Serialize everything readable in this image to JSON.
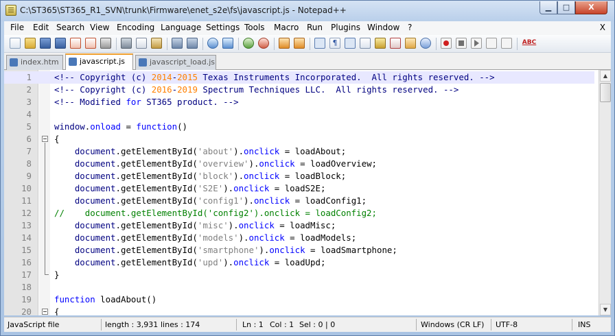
{
  "window": {
    "title": "C:\\ST365\\ST365_R1_SVN\\trunk\\Firmware\\enet_s2e\\fs\\javascript.js - Notepad++",
    "minimize": "▁",
    "maximize": "□",
    "close": "X"
  },
  "menu": {
    "items": [
      "File",
      "Edit",
      "Search",
      "View",
      "Encoding",
      "Language",
      "Settings",
      "Tools",
      "Macro",
      "Run",
      "Plugins",
      "Window",
      "?"
    ],
    "close": "X"
  },
  "toolbar": {
    "icons": [
      "new-file-icon",
      "open-file-icon",
      "save-icon",
      "save-all-icon",
      "close-icon",
      "close-all-icon",
      "print-icon",
      "cut-icon",
      "copy-icon",
      "paste-icon",
      "undo-icon",
      "redo-icon",
      "find-icon",
      "replace-icon",
      "zoom-in-icon",
      "zoom-out-icon",
      "sync-vertical-icon",
      "sync-horizontal-icon",
      "word-wrap-icon",
      "show-all-chars-icon",
      "indent-guide-icon",
      "user-lang-icon",
      "doc-map-icon",
      "function-list-icon",
      "folder-workspace-icon",
      "monitoring-icon",
      "record-macro-icon",
      "stop-macro-icon",
      "play-macro-icon",
      "run-macro-multiple-icon",
      "save-macro-icon",
      "spell-check-icon"
    ]
  },
  "tabs": [
    {
      "label": "index.htm",
      "active": false
    },
    {
      "label": "javascript.js",
      "active": true
    },
    {
      "label": "javascript_load.js",
      "active": false
    }
  ],
  "editor": {
    "lines": [
      {
        "n": "1",
        "tokens": [
          [
            "c-comment",
            "<!-- Copyright (c) "
          ],
          [
            "c-year",
            "2014"
          ],
          [
            "c-comment",
            "-"
          ],
          [
            "c-year",
            "2015"
          ],
          [
            "c-comment",
            " Texas Instruments Incorporated.  All rights reserved. -->"
          ]
        ]
      },
      {
        "n": "2",
        "tokens": [
          [
            "c-comment",
            "<!-- Copyright (c) "
          ],
          [
            "c-year",
            "2016"
          ],
          [
            "c-comment",
            "-"
          ],
          [
            "c-year",
            "2019"
          ],
          [
            "c-comment",
            " Spectrum Techniques LLC.  All rights reserved. -->"
          ]
        ]
      },
      {
        "n": "3",
        "tokens": [
          [
            "c-comment",
            "<!-- Modified "
          ],
          [
            "c-kw",
            "for"
          ],
          [
            "c-comment",
            " ST365 product. -->"
          ]
        ]
      },
      {
        "n": "4",
        "tokens": []
      },
      {
        "n": "5",
        "tokens": [
          [
            "c-obj",
            "window"
          ],
          [
            "c-plain",
            "."
          ],
          [
            "c-prop",
            "onload"
          ],
          [
            "c-plain",
            " = "
          ],
          [
            "c-kw",
            "function"
          ],
          [
            "c-plain",
            "()"
          ]
        ]
      },
      {
        "n": "6",
        "tokens": [
          [
            "c-plain",
            "{"
          ]
        ]
      },
      {
        "n": "7",
        "tokens": [
          [
            "c-plain",
            "    "
          ],
          [
            "c-obj",
            "document"
          ],
          [
            "c-plain",
            ".getElementById("
          ],
          [
            "c-str",
            "'about'"
          ],
          [
            "c-plain",
            ")."
          ],
          [
            "c-prop",
            "onclick"
          ],
          [
            "c-plain",
            " = loadAbout;"
          ]
        ]
      },
      {
        "n": "8",
        "tokens": [
          [
            "c-plain",
            "    "
          ],
          [
            "c-obj",
            "document"
          ],
          [
            "c-plain",
            ".getElementById("
          ],
          [
            "c-str",
            "'overview'"
          ],
          [
            "c-plain",
            ")."
          ],
          [
            "c-prop",
            "onclick"
          ],
          [
            "c-plain",
            " = loadOverview;"
          ]
        ]
      },
      {
        "n": "9",
        "tokens": [
          [
            "c-plain",
            "    "
          ],
          [
            "c-obj",
            "document"
          ],
          [
            "c-plain",
            ".getElementById("
          ],
          [
            "c-str",
            "'block'"
          ],
          [
            "c-plain",
            ")."
          ],
          [
            "c-prop",
            "onclick"
          ],
          [
            "c-plain",
            " = loadBlock;"
          ]
        ]
      },
      {
        "n": "10",
        "tokens": [
          [
            "c-plain",
            "    "
          ],
          [
            "c-obj",
            "document"
          ],
          [
            "c-plain",
            ".getElementById("
          ],
          [
            "c-str",
            "'S2E'"
          ],
          [
            "c-plain",
            ")."
          ],
          [
            "c-prop",
            "onclick"
          ],
          [
            "c-plain",
            " = loadS2E;"
          ]
        ]
      },
      {
        "n": "11",
        "tokens": [
          [
            "c-plain",
            "    "
          ],
          [
            "c-obj",
            "document"
          ],
          [
            "c-plain",
            ".getElementById("
          ],
          [
            "c-str",
            "'config1'"
          ],
          [
            "c-plain",
            ")."
          ],
          [
            "c-prop",
            "onclick"
          ],
          [
            "c-plain",
            " = loadConfig1;"
          ]
        ]
      },
      {
        "n": "12",
        "tokens": [
          [
            "c-sl",
            "//    document.getElementById('config2').onclick = loadConfig2;"
          ]
        ]
      },
      {
        "n": "13",
        "tokens": [
          [
            "c-plain",
            "    "
          ],
          [
            "c-obj",
            "document"
          ],
          [
            "c-plain",
            ".getElementById("
          ],
          [
            "c-str",
            "'misc'"
          ],
          [
            "c-plain",
            ")."
          ],
          [
            "c-prop",
            "onclick"
          ],
          [
            "c-plain",
            " = loadMisc;"
          ]
        ]
      },
      {
        "n": "14",
        "tokens": [
          [
            "c-plain",
            "    "
          ],
          [
            "c-obj",
            "document"
          ],
          [
            "c-plain",
            ".getElementById("
          ],
          [
            "c-str",
            "'models'"
          ],
          [
            "c-plain",
            ")."
          ],
          [
            "c-prop",
            "onclick"
          ],
          [
            "c-plain",
            " = loadModels;"
          ]
        ]
      },
      {
        "n": "15",
        "tokens": [
          [
            "c-plain",
            "    "
          ],
          [
            "c-obj",
            "document"
          ],
          [
            "c-plain",
            ".getElementById("
          ],
          [
            "c-str",
            "'smartphone'"
          ],
          [
            "c-plain",
            ")."
          ],
          [
            "c-prop",
            "onclick"
          ],
          [
            "c-plain",
            " = loadSmartphone;"
          ]
        ]
      },
      {
        "n": "16",
        "tokens": [
          [
            "c-plain",
            "    "
          ],
          [
            "c-obj",
            "document"
          ],
          [
            "c-plain",
            ".getElementById("
          ],
          [
            "c-str",
            "'upd'"
          ],
          [
            "c-plain",
            ")."
          ],
          [
            "c-prop",
            "onclick"
          ],
          [
            "c-plain",
            " = loadUpd;"
          ]
        ]
      },
      {
        "n": "17",
        "tokens": [
          [
            "c-plain",
            "}"
          ]
        ]
      },
      {
        "n": "18",
        "tokens": []
      },
      {
        "n": "19",
        "tokens": [
          [
            "c-kw",
            "function"
          ],
          [
            "c-plain",
            " loadAbout()"
          ]
        ]
      },
      {
        "n": "20",
        "tokens": [
          [
            "c-plain",
            "{"
          ]
        ]
      }
    ]
  },
  "status": {
    "file_type": "JavaScript file",
    "length": "length : 3,931",
    "lines": "lines : 174",
    "ln": "Ln : 1",
    "col": "Col : 1",
    "sel": "Sel : 0 | 0",
    "eol": "Windows (CR LF)",
    "encoding": "UTF-8",
    "mode": "INS"
  },
  "colors": {
    "comment": "#000080",
    "year": "#ff8000",
    "keyword": "#0000ff",
    "string": "#808080",
    "line_comment": "#008000",
    "current_line": "#e8e8ff"
  }
}
